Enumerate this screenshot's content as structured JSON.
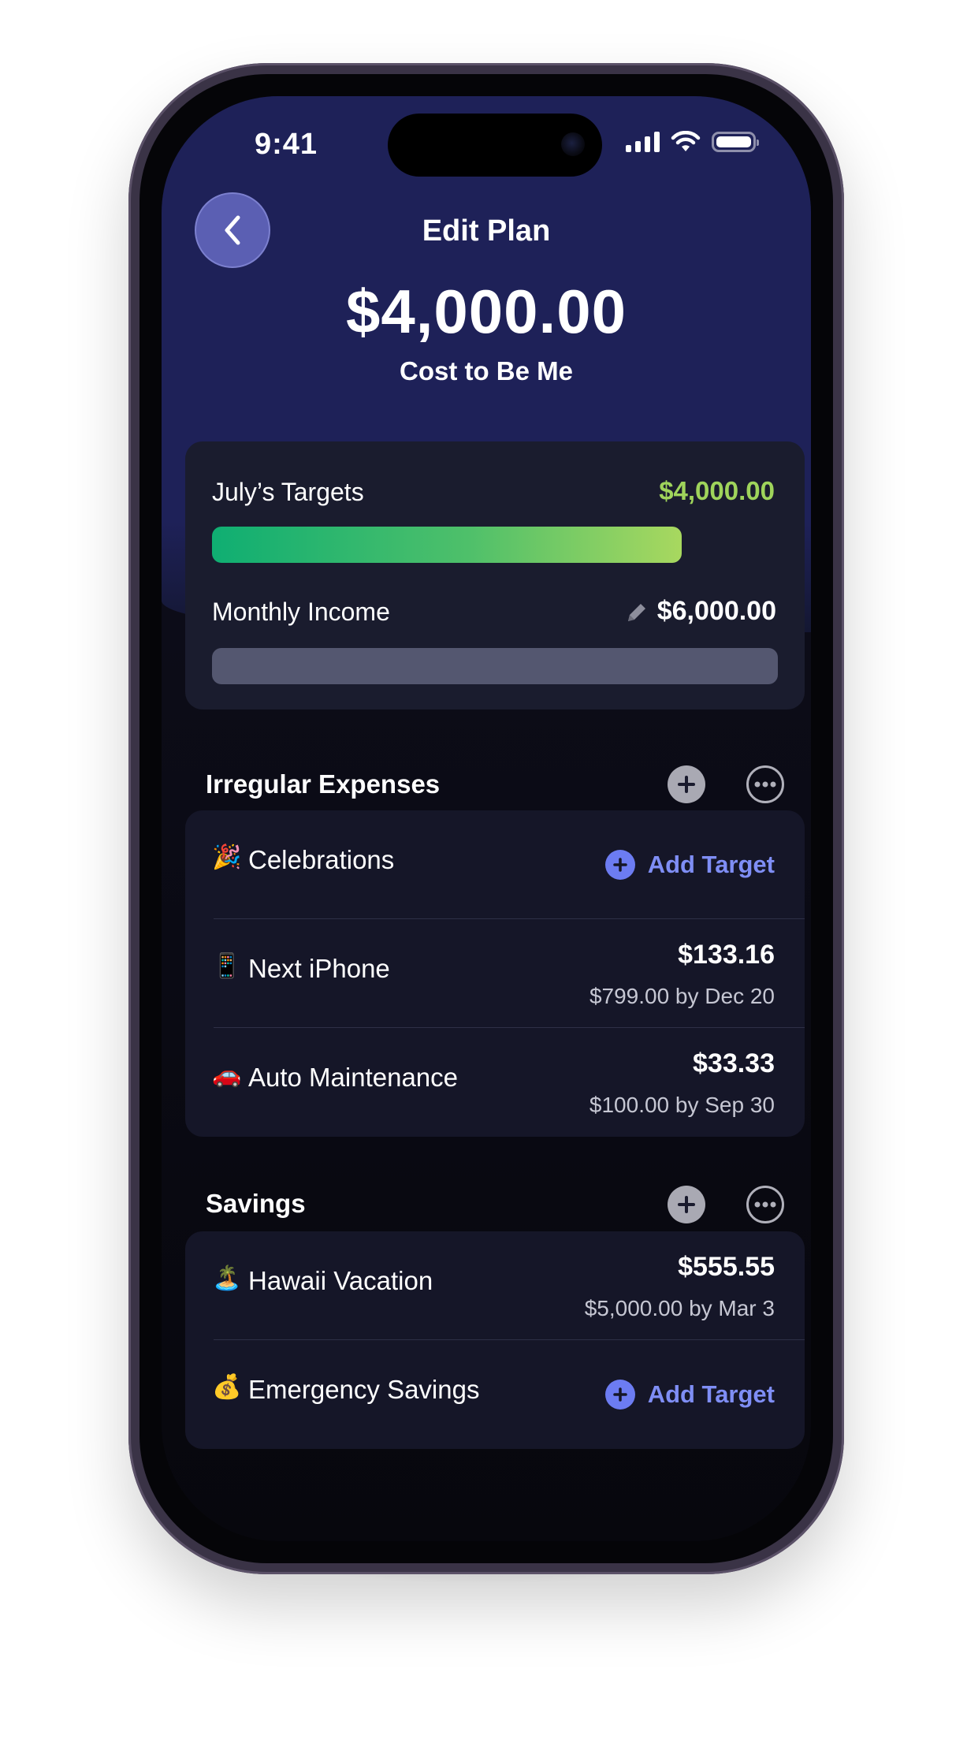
{
  "status": {
    "time": "9:41"
  },
  "header": {
    "title": "Edit Plan",
    "amount": "$4,000.00",
    "caption": "Cost to Be Me"
  },
  "targets_card": {
    "targets_label": "July’s Targets",
    "targets_amount": "$4,000.00",
    "targets_progress": 0.83,
    "income_label": "Monthly Income",
    "income_amount": "$6,000.00"
  },
  "sections": [
    {
      "title": "Irregular Expenses",
      "items": [
        {
          "emoji": "🎉",
          "name": "Celebrations",
          "add_label": "Add Target"
        },
        {
          "emoji": "📱",
          "name": "Next iPhone",
          "amount": "$133.16",
          "detail": "$799.00 by Dec 20"
        },
        {
          "emoji": "🚗",
          "name": "Auto Maintenance",
          "amount": "$33.33",
          "detail": "$100.00 by Sep 30"
        }
      ]
    },
    {
      "title": "Savings",
      "items": [
        {
          "emoji": "🏝️",
          "name": "Hawaii Vacation",
          "amount": "$555.55",
          "detail": "$5,000.00 by Mar 3"
        },
        {
          "emoji": "💰",
          "name": "Emergency Savings",
          "add_label": "Add Target"
        }
      ]
    }
  ],
  "colors": {
    "header_bg": "#1e2158",
    "accent_green": "#9fd45b",
    "accent_blue": "#7f8ef5"
  }
}
